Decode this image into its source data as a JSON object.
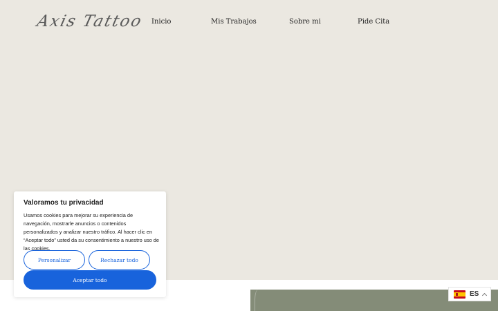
{
  "header": {
    "logo_text": "Axis Tattoo",
    "nav": [
      {
        "label": "Inicio"
      },
      {
        "label": "Mis Trabajos"
      },
      {
        "label": "Sobre mi"
      },
      {
        "label": "Pide Cita"
      }
    ]
  },
  "cookie_banner": {
    "title": "Valoramos tu privacidad",
    "body": "Usamos cookies para mejorar su experiencia de navegación, mostrarle anuncios o contenidos personalizados y analizar nuestro tráfico. Al hacer clic en “Aceptar todo” usted da su consentimiento a nuestro uso de las cookies.",
    "customize_label": "Personalizar",
    "reject_label": "Rechazar todo",
    "accept_label": "Aceptar todo",
    "accent_color": "#1863dc"
  },
  "language_switcher": {
    "code": "ES",
    "flag_icon": "spain-flag-icon"
  },
  "colors": {
    "page_background": "#ebe8e1",
    "photo_tint": "#848c78"
  }
}
